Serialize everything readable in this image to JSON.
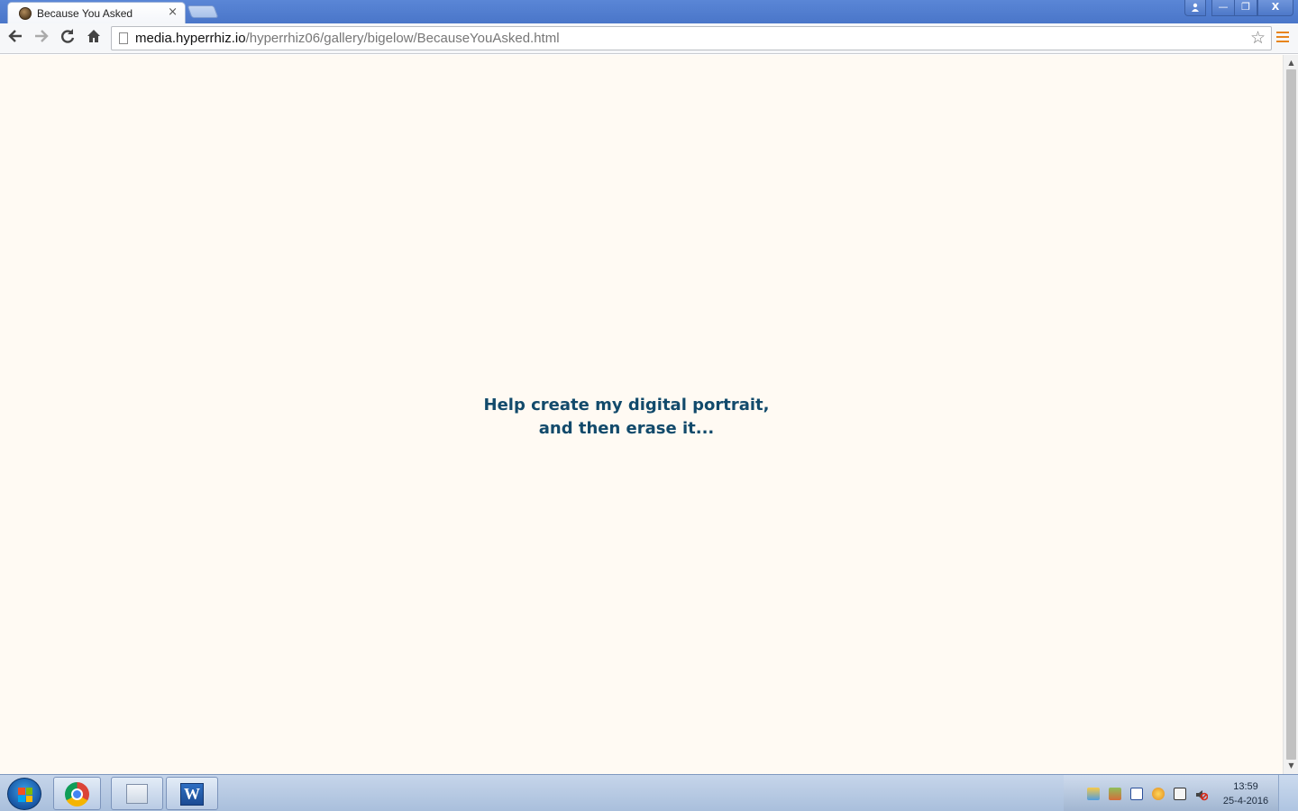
{
  "browser": {
    "tab": {
      "title": "Because You Asked",
      "close_glyph": "×",
      "favicon": "portrait-favicon"
    },
    "window_controls": {
      "user": "user-icon",
      "minimize": "—",
      "maximize": "❐",
      "close": "X"
    },
    "toolbar": {
      "back": "back-arrow-icon",
      "forward": "forward-arrow-icon",
      "reload": "reload-icon",
      "home": "home-icon",
      "url_host": "media.hyperrhiz.io",
      "url_path": "/hyperrhiz06/gallery/bigelow/BecauseYouAsked.html",
      "bookmark": "star-icon",
      "menu": "hamburger-menu-icon"
    }
  },
  "page": {
    "background": "#fffaf3",
    "text_color": "#124a6b",
    "message_line1": "Help create my digital portrait,",
    "message_line2": "and then erase it..."
  },
  "taskbar": {
    "apps": [
      "chrome-icon",
      "explorer-icon",
      "word-icon"
    ],
    "word_letter": "W",
    "clock_time": "13:59",
    "clock_date": "25-4-2016"
  }
}
